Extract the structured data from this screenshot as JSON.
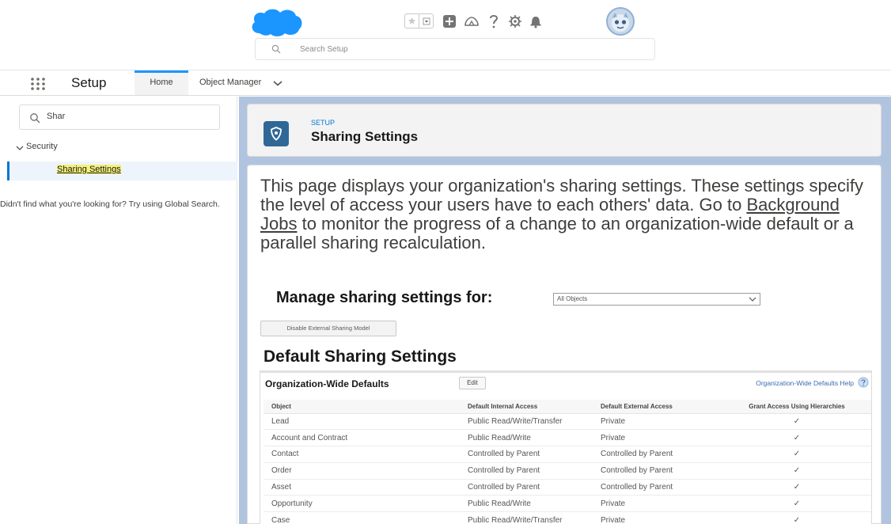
{
  "header": {
    "search_placeholder": "Search Setup"
  },
  "nav": {
    "app_name": "Setup",
    "tabs": [
      {
        "label": "Home"
      },
      {
        "label": "Object Manager"
      }
    ]
  },
  "sidebar": {
    "quick_find_value": "Shar",
    "section_label": "Security",
    "selected_item": "Sharing Settings",
    "not_found_text": "Didn't find what you're looking for? Try using Global Search."
  },
  "page_header": {
    "eyebrow": "SETUP",
    "title": "Sharing Settings"
  },
  "content": {
    "intro_before": "This page displays your organization's sharing settings. These settings specify the level of access your users have to each others' data. Go to ",
    "intro_link": "Background Jobs",
    "intro_after": " to monitor the progress of a change to an organization-wide default or a parallel sharing recalculation.",
    "manage_label": "Manage sharing settings for:",
    "manage_value": "All Objects",
    "disable_button": "Disable External Sharing Model",
    "section_title": "Default Sharing Settings"
  },
  "owd": {
    "title": "Organization-Wide Defaults",
    "edit_label": "Edit",
    "help_label": "Organization-Wide Defaults Help",
    "columns": [
      "Object",
      "Default Internal Access",
      "Default External Access",
      "Grant Access Using Hierarchies"
    ],
    "rows": [
      {
        "object": "Lead",
        "internal": "Public Read/Write/Transfer",
        "external": "Private",
        "grant": "✓"
      },
      {
        "object": "Account and Contract",
        "internal": "Public Read/Write",
        "external": "Private",
        "grant": "✓"
      },
      {
        "object": "Contact",
        "internal": "Controlled by Parent",
        "external": "Controlled by Parent",
        "grant": "✓"
      },
      {
        "object": "Order",
        "internal": "Controlled by Parent",
        "external": "Controlled by Parent",
        "grant": "✓"
      },
      {
        "object": "Asset",
        "internal": "Controlled by Parent",
        "external": "Controlled by Parent",
        "grant": "✓"
      },
      {
        "object": "Opportunity",
        "internal": "Public Read/Write",
        "external": "Private",
        "grant": "✓"
      },
      {
        "object": "Case",
        "internal": "Public Read/Write/Transfer",
        "external": "Private",
        "grant": "✓"
      }
    ]
  },
  "colors": {
    "brand_blue": "#0176d3",
    "cloud_blue": "#1b96ff",
    "main_background": "#b0c4df",
    "header_icon_bg": "#2f6896",
    "highlight": "#f4f27a"
  },
  "icons": [
    "salesforce-cloud-logo",
    "star-icon",
    "chevron-down-icon",
    "add-icon",
    "trailhead-icon",
    "help-icon",
    "gear-icon",
    "bell-icon",
    "avatar",
    "search-icon",
    "app-launcher-icon",
    "shield-icon",
    "checkmark-icon"
  ]
}
